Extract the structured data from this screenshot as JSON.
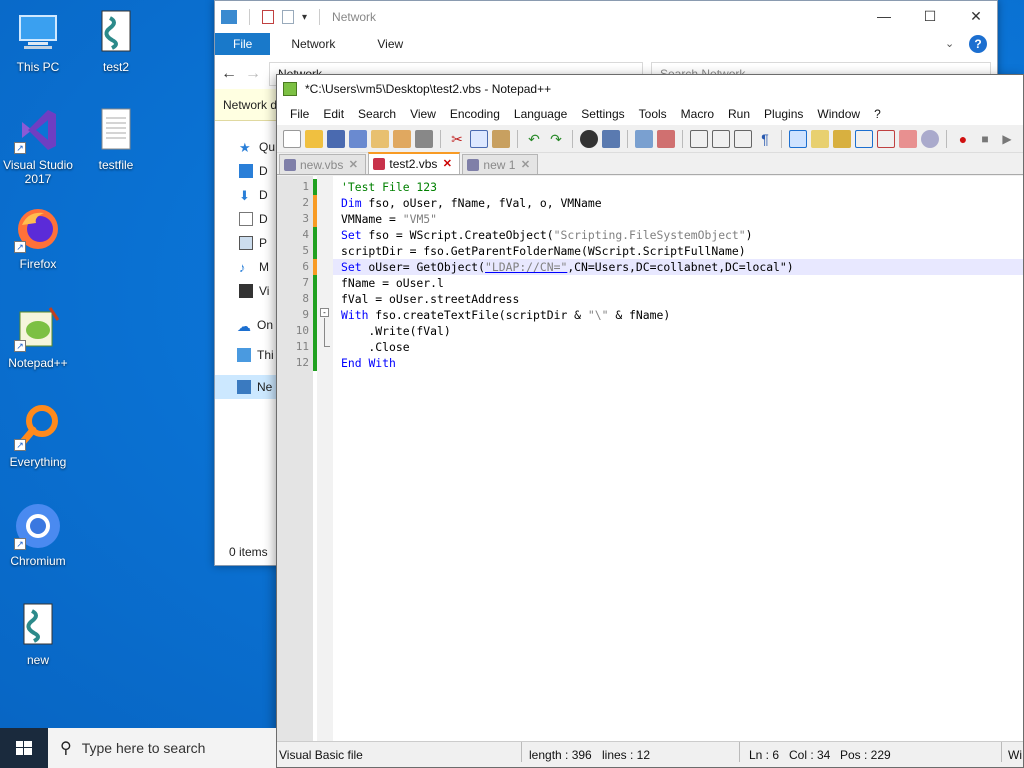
{
  "desktop": {
    "icons": [
      {
        "label": "This PC"
      },
      {
        "label": "test2"
      },
      {
        "label": "Visual Studio 2017"
      },
      {
        "label": "testfile"
      },
      {
        "label": "Firefox"
      },
      {
        "label": "Notepad++"
      },
      {
        "label": "Everything"
      },
      {
        "label": "Chromium"
      },
      {
        "label": "new"
      }
    ]
  },
  "explorer": {
    "title": "Network",
    "ribbon_tabs": [
      "File",
      "Network",
      "View"
    ],
    "address": "Network",
    "search_placeholder": "Search Network",
    "banner_text": "Network d",
    "nav_items": [
      "Qu",
      "D",
      "D",
      "D",
      "P",
      "M",
      "Vi",
      "On",
      "Thi",
      "Ne"
    ],
    "status": "0 items"
  },
  "notepad": {
    "title": "*C:\\Users\\vm5\\Desktop\\test2.vbs - Notepad++",
    "menu": [
      "File",
      "Edit",
      "Search",
      "View",
      "Encoding",
      "Language",
      "Settings",
      "Tools",
      "Macro",
      "Run",
      "Plugins",
      "Window",
      "?"
    ],
    "tabs": [
      {
        "label": "new.vbs",
        "active": false
      },
      {
        "label": "test2.vbs",
        "active": true
      },
      {
        "label": "new 1",
        "active": false
      }
    ],
    "line_numbers": [
      "1",
      "2",
      "3",
      "4",
      "5",
      "6",
      "7",
      "8",
      "9",
      "10",
      "11",
      "12"
    ],
    "current_line": 6,
    "status": {
      "type": "Visual Basic file",
      "length": "length : 396",
      "lines": "lines : 12",
      "ln": "Ln : 6",
      "col": "Col : 34",
      "pos": "Pos : 229",
      "eol": "Wi"
    }
  },
  "taskbar": {
    "search_placeholder": "Type here to search"
  },
  "colors": {
    "desktop_blue": "#0b74d6",
    "change_modified": "#f89b24",
    "change_saved": "#20a020",
    "keyword": "#0000ff",
    "comment": "#008000",
    "string": "#808080"
  }
}
